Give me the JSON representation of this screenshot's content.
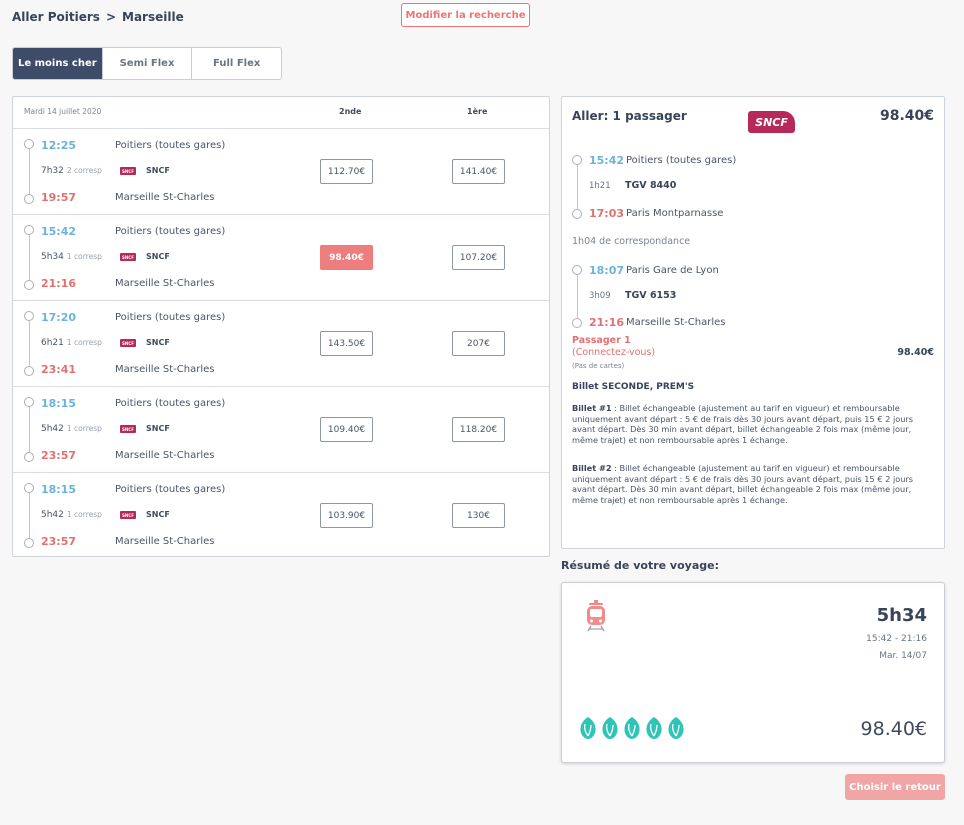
{
  "route": {
    "from": "Aller Poitiers",
    "separator": ">",
    "to": "Marseille"
  },
  "modify_button": "Modifier la recherche",
  "fare_tabs": [
    {
      "label": "Le moins cher",
      "active": true
    },
    {
      "label": "Semi Flex",
      "active": false
    },
    {
      "label": "Full Flex",
      "active": false
    }
  ],
  "results": {
    "date": "Mardi 14 juillet 2020",
    "col_second": "2nde",
    "col_first": "1ère",
    "journeys": [
      {
        "dep_time": "12:25",
        "dep_station": "Poitiers (toutes gares)",
        "duration": "7h32",
        "connections": "2 corresp",
        "carrier": "SNCF",
        "arr_time": "19:57",
        "arr_station": "Marseille St-Charles",
        "price_second": "112.70€",
        "price_first": "141.40€",
        "best": false
      },
      {
        "dep_time": "15:42",
        "dep_station": "Poitiers (toutes gares)",
        "duration": "5h34",
        "connections": "1 corresp",
        "carrier": "SNCF",
        "arr_time": "21:16",
        "arr_station": "Marseille St-Charles",
        "price_second": "98.40€",
        "price_first": "107.20€",
        "best": true
      },
      {
        "dep_time": "17:20",
        "dep_station": "Poitiers (toutes gares)",
        "duration": "6h21",
        "connections": "1 corresp",
        "carrier": "SNCF",
        "arr_time": "23:41",
        "arr_station": "Marseille St-Charles",
        "price_second": "143.50€",
        "price_first": "207€",
        "best": false
      },
      {
        "dep_time": "18:15",
        "dep_station": "Poitiers (toutes gares)",
        "duration": "5h42",
        "connections": "1 corresp",
        "carrier": "SNCF",
        "arr_time": "23:57",
        "arr_station": "Marseille St-Charles",
        "price_second": "109.40€",
        "price_first": "118.20€",
        "best": false
      },
      {
        "dep_time": "18:15",
        "dep_station": "Poitiers (toutes gares)",
        "duration": "5h42",
        "connections": "1 corresp",
        "carrier": "SNCF",
        "arr_time": "23:57",
        "arr_station": "Marseille St-Charles",
        "price_second": "103.90€",
        "price_first": "130€",
        "best": false
      }
    ]
  },
  "detail": {
    "title": "Aller: 1 passager",
    "logo_text": "SNCF",
    "price": "98.40€",
    "segments": [
      {
        "dep_time": "15:42",
        "dep_station": "Poitiers (toutes gares)",
        "duration": "1h21",
        "train": "TGV 8440",
        "arr_time": "17:03",
        "arr_station": "Paris Montparnasse"
      },
      {
        "dep_time": "18:07",
        "dep_station": "Paris Gare de Lyon",
        "duration": "3h09",
        "train": "TGV 6153",
        "arr_time": "21:16",
        "arr_station": "Marseille St-Charles"
      }
    ],
    "connection": "1h04 de correspondance",
    "passenger": {
      "label": "Passager 1",
      "login": "(Connectez-vous)",
      "cards": "(Pas de cartes)",
      "price": "98.40€"
    },
    "ticket_type": "Billet SECONDE, PREM'S",
    "conditions": [
      {
        "title": "Billet #1",
        "text": " : Billet échangeable (ajustement au tarif en vigueur) et remboursable uniquement avant départ : 5 € de frais dès 30 jours avant départ, puis 15 € 2 jours avant départ. Dès 30 min avant départ, billet échangeable 2 fois max (même jour, même trajet) et non remboursable après 1 échange."
      },
      {
        "title": "Billet #2",
        "text": " : Billet échangeable (ajustement au tarif en vigueur) et remboursable uniquement avant départ : 5 € de frais dès 30 jours avant départ, puis 15 € 2 jours avant départ. Dès 30 min avant départ, billet échangeable 2 fois max (même jour, même trajet) et non remboursable après 1 échange."
      }
    ]
  },
  "summary": {
    "title": "Résumé de votre voyage:",
    "icon": "train-icon",
    "duration": "5h34",
    "times": "15:42 - 21:16",
    "date": "Mar. 14/07",
    "eco_leaves": 5,
    "price": "98.40€"
  },
  "return_button": "Choisir le retour",
  "colors": {
    "accent": "#ee7474",
    "departure": "#6cb3dc",
    "arrival": "#e37070",
    "nav": "#3e4c6a",
    "brand_sncf": "#b52a5a",
    "eco": "#2ec4b6"
  }
}
